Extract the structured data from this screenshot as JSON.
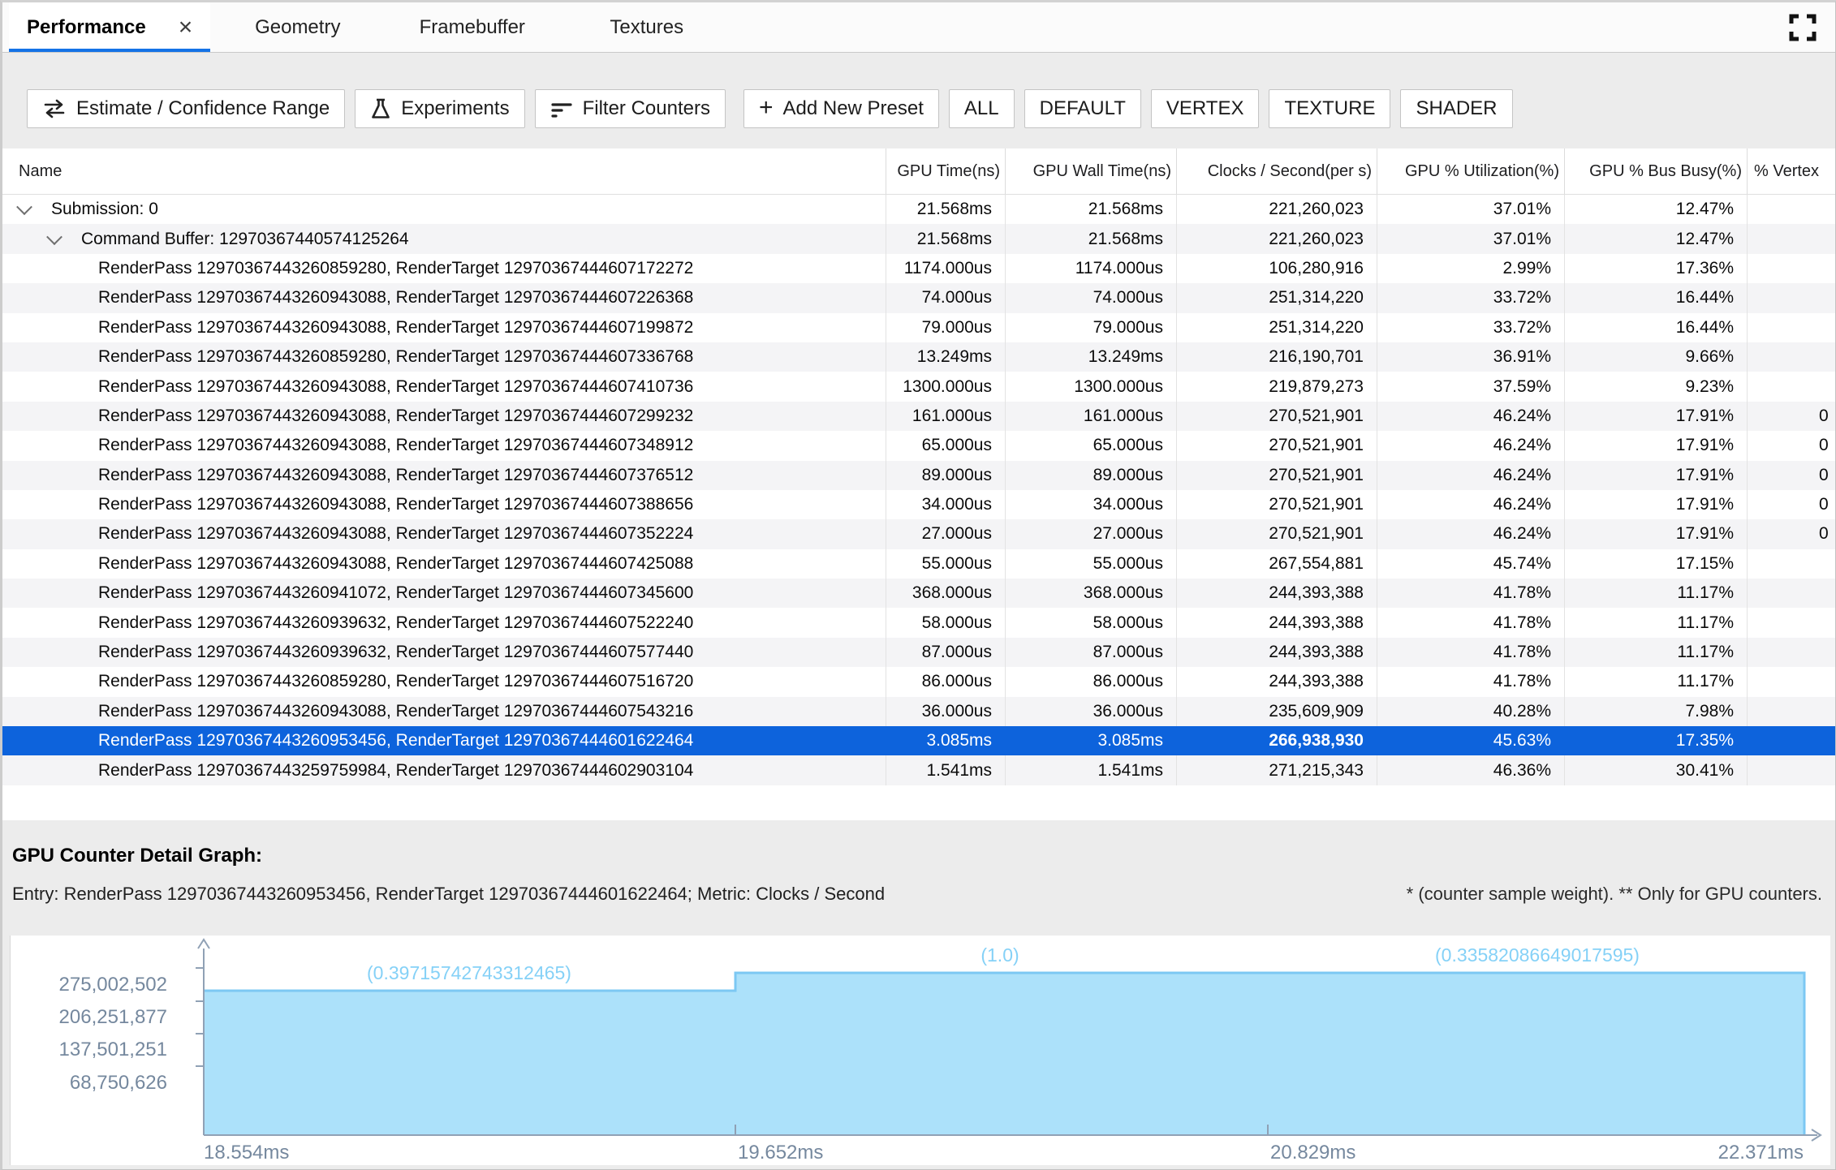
{
  "tabs": {
    "items": [
      {
        "label": "Performance",
        "active": true
      },
      {
        "label": "Geometry",
        "active": false
      },
      {
        "label": "Framebuffer",
        "active": false
      },
      {
        "label": "Textures",
        "active": false
      }
    ],
    "close_glyph": "×"
  },
  "toolbar": {
    "buttons": {
      "estimate": "Estimate / Confidence Range",
      "experiments": "Experiments",
      "filter": "Filter Counters",
      "add_preset": "Add New Preset"
    },
    "presets": [
      "ALL",
      "DEFAULT",
      "VERTEX",
      "TEXTURE",
      "SHADER"
    ]
  },
  "table": {
    "columns": [
      "Name",
      "GPU Time(ns)",
      "GPU Wall Time(ns)",
      "Clocks / Second(per s)",
      "GPU % Utilization(%)",
      "GPU % Bus Busy(%)",
      "% Vertex"
    ],
    "rows": [
      {
        "level": 0,
        "expandable": true,
        "selected": false,
        "name": "Submission: 0",
        "gpu_time": "21.568ms",
        "gpu_wall_time": "21.568ms",
        "clocks": "221,260,023",
        "utilization": "37.01%",
        "bus_busy": "12.47%",
        "vertex": ""
      },
      {
        "level": 1,
        "expandable": true,
        "selected": false,
        "name": "Command Buffer: 12970367440574125264",
        "gpu_time": "21.568ms",
        "gpu_wall_time": "21.568ms",
        "clocks": "221,260,023",
        "utilization": "37.01%",
        "bus_busy": "12.47%",
        "vertex": ""
      },
      {
        "level": 2,
        "expandable": false,
        "selected": false,
        "name": "RenderPass 12970367443260859280, RenderTarget 12970367444607172272",
        "gpu_time": "1174.000us",
        "gpu_wall_time": "1174.000us",
        "clocks": "106,280,916",
        "utilization": "2.99%",
        "bus_busy": "17.36%",
        "vertex": ""
      },
      {
        "level": 2,
        "expandable": false,
        "selected": false,
        "name": "RenderPass 12970367443260943088, RenderTarget 12970367444607226368",
        "gpu_time": "74.000us",
        "gpu_wall_time": "74.000us",
        "clocks": "251,314,220",
        "utilization": "33.72%",
        "bus_busy": "16.44%",
        "vertex": ""
      },
      {
        "level": 2,
        "expandable": false,
        "selected": false,
        "name": "RenderPass 12970367443260943088, RenderTarget 12970367444607199872",
        "gpu_time": "79.000us",
        "gpu_wall_time": "79.000us",
        "clocks": "251,314,220",
        "utilization": "33.72%",
        "bus_busy": "16.44%",
        "vertex": ""
      },
      {
        "level": 2,
        "expandable": false,
        "selected": false,
        "name": "RenderPass 12970367443260859280, RenderTarget 12970367444607336768",
        "gpu_time": "13.249ms",
        "gpu_wall_time": "13.249ms",
        "clocks": "216,190,701",
        "utilization": "36.91%",
        "bus_busy": "9.66%",
        "vertex": ""
      },
      {
        "level": 2,
        "expandable": false,
        "selected": false,
        "name": "RenderPass 12970367443260943088, RenderTarget 12970367444607410736",
        "gpu_time": "1300.000us",
        "gpu_wall_time": "1300.000us",
        "clocks": "219,879,273",
        "utilization": "37.59%",
        "bus_busy": "9.23%",
        "vertex": ""
      },
      {
        "level": 2,
        "expandable": false,
        "selected": false,
        "name": "RenderPass 12970367443260943088, RenderTarget 12970367444607299232",
        "gpu_time": "161.000us",
        "gpu_wall_time": "161.000us",
        "clocks": "270,521,901",
        "utilization": "46.24%",
        "bus_busy": "17.91%",
        "vertex": "0"
      },
      {
        "level": 2,
        "expandable": false,
        "selected": false,
        "name": "RenderPass 12970367443260943088, RenderTarget 12970367444607348912",
        "gpu_time": "65.000us",
        "gpu_wall_time": "65.000us",
        "clocks": "270,521,901",
        "utilization": "46.24%",
        "bus_busy": "17.91%",
        "vertex": "0"
      },
      {
        "level": 2,
        "expandable": false,
        "selected": false,
        "name": "RenderPass 12970367443260943088, RenderTarget 12970367444607376512",
        "gpu_time": "89.000us",
        "gpu_wall_time": "89.000us",
        "clocks": "270,521,901",
        "utilization": "46.24%",
        "bus_busy": "17.91%",
        "vertex": "0"
      },
      {
        "level": 2,
        "expandable": false,
        "selected": false,
        "name": "RenderPass 12970367443260943088, RenderTarget 12970367444607388656",
        "gpu_time": "34.000us",
        "gpu_wall_time": "34.000us",
        "clocks": "270,521,901",
        "utilization": "46.24%",
        "bus_busy": "17.91%",
        "vertex": "0"
      },
      {
        "level": 2,
        "expandable": false,
        "selected": false,
        "name": "RenderPass 12970367443260943088, RenderTarget 12970367444607352224",
        "gpu_time": "27.000us",
        "gpu_wall_time": "27.000us",
        "clocks": "270,521,901",
        "utilization": "46.24%",
        "bus_busy": "17.91%",
        "vertex": "0"
      },
      {
        "level": 2,
        "expandable": false,
        "selected": false,
        "name": "RenderPass 12970367443260943088, RenderTarget 12970367444607425088",
        "gpu_time": "55.000us",
        "gpu_wall_time": "55.000us",
        "clocks": "267,554,881",
        "utilization": "45.74%",
        "bus_busy": "17.15%",
        "vertex": ""
      },
      {
        "level": 2,
        "expandable": false,
        "selected": false,
        "name": "RenderPass 12970367443260941072, RenderTarget 12970367444607345600",
        "gpu_time": "368.000us",
        "gpu_wall_time": "368.000us",
        "clocks": "244,393,388",
        "utilization": "41.78%",
        "bus_busy": "11.17%",
        "vertex": ""
      },
      {
        "level": 2,
        "expandable": false,
        "selected": false,
        "name": "RenderPass 12970367443260939632, RenderTarget 12970367444607522240",
        "gpu_time": "58.000us",
        "gpu_wall_time": "58.000us",
        "clocks": "244,393,388",
        "utilization": "41.78%",
        "bus_busy": "11.17%",
        "vertex": ""
      },
      {
        "level": 2,
        "expandable": false,
        "selected": false,
        "name": "RenderPass 12970367443260939632, RenderTarget 12970367444607577440",
        "gpu_time": "87.000us",
        "gpu_wall_time": "87.000us",
        "clocks": "244,393,388",
        "utilization": "41.78%",
        "bus_busy": "11.17%",
        "vertex": ""
      },
      {
        "level": 2,
        "expandable": false,
        "selected": false,
        "name": "RenderPass 12970367443260859280, RenderTarget 12970367444607516720",
        "gpu_time": "86.000us",
        "gpu_wall_time": "86.000us",
        "clocks": "244,393,388",
        "utilization": "41.78%",
        "bus_busy": "11.17%",
        "vertex": ""
      },
      {
        "level": 2,
        "expandable": false,
        "selected": false,
        "name": "RenderPass 12970367443260943088, RenderTarget 12970367444607543216",
        "gpu_time": "36.000us",
        "gpu_wall_time": "36.000us",
        "clocks": "235,609,909",
        "utilization": "40.28%",
        "bus_busy": "7.98%",
        "vertex": ""
      },
      {
        "level": 2,
        "expandable": false,
        "selected": true,
        "name": "RenderPass 12970367443260953456, RenderTarget 12970367444601622464",
        "gpu_time": "3.085ms",
        "gpu_wall_time": "3.085ms",
        "clocks": "266,938,930",
        "utilization": "45.63%",
        "bus_busy": "17.35%",
        "vertex": ""
      },
      {
        "level": 2,
        "expandable": false,
        "selected": false,
        "name": "RenderPass 12970367443259759984, RenderTarget 12970367444602903104",
        "gpu_time": "1.541ms",
        "gpu_wall_time": "1.541ms",
        "clocks": "271,215,343",
        "utilization": "46.36%",
        "bus_busy": "30.41%",
        "vertex": ""
      }
    ]
  },
  "detail": {
    "title": "GPU Counter Detail Graph:",
    "entry": "Entry: RenderPass 12970367443260953456, RenderTarget 12970367444601622464; Metric: Clocks / Second",
    "note": "* (counter sample weight). ** Only for GPU counters."
  },
  "chart_data": {
    "type": "area",
    "subtype": "step",
    "metric": "Clocks / Second",
    "x_unit": "ms",
    "x_tick_labels": [
      "18.554ms",
      "19.652ms",
      "20.829ms",
      "22.371ms"
    ],
    "y_tick_labels": [
      "275,002,502",
      "206,251,877",
      "137,501,251",
      "68,750,626"
    ],
    "annotations": [
      "(0.39715742743312465)",
      "(1.0)",
      "(0.33582086649017595)"
    ],
    "segments": [
      {
        "x_start": 18.554,
        "x_end": 19.652,
        "counter_weight": 0.39715742743312465,
        "approx_value": 230000000
      },
      {
        "x_start": 19.652,
        "x_end": 20.829,
        "counter_weight": 1.0,
        "approx_value": 266938930
      },
      {
        "x_start": 20.829,
        "x_end": 22.371,
        "counter_weight": 0.33582086649017595,
        "approx_value": 266938930
      }
    ],
    "grid": false,
    "legend_position": "none",
    "colors": {
      "area_fill": "#ace1fa",
      "area_edge": "#7cc8f3",
      "axis": "#90a1b5",
      "labels": "#75889e",
      "annotation": "#85d1f7",
      "selection_blue": "#0d63dc",
      "tab_underline": "#1573e6"
    }
  }
}
